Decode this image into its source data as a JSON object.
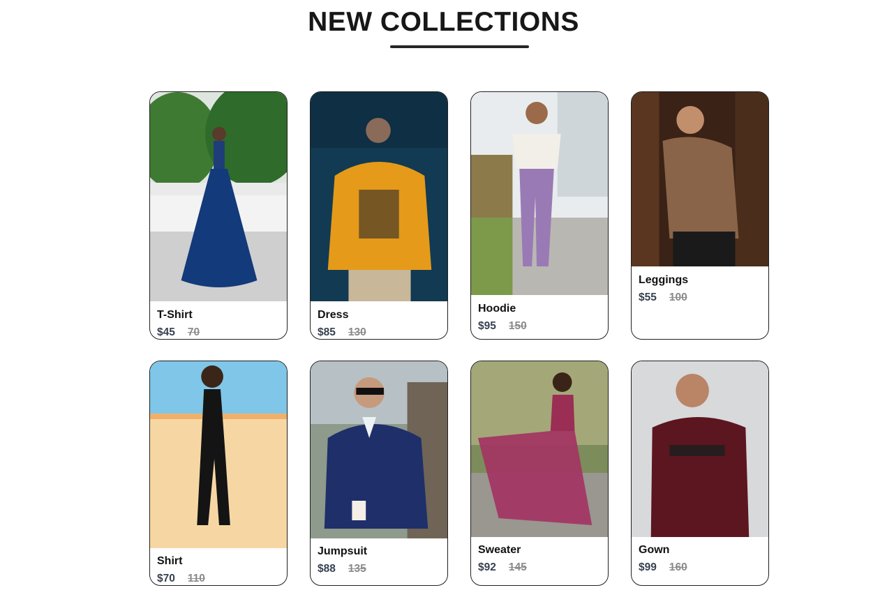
{
  "section": {
    "title": "NEW COLLECTIONS"
  },
  "products": [
    {
      "name": "T-Shirt",
      "new_price": "$45",
      "old_price": "70"
    },
    {
      "name": "Dress",
      "new_price": "$85",
      "old_price": "130"
    },
    {
      "name": "Hoodie",
      "new_price": "$95",
      "old_price": "150"
    },
    {
      "name": "Leggings",
      "new_price": "$55",
      "old_price": "100"
    },
    {
      "name": "Shirt",
      "new_price": "$70",
      "old_price": "110"
    },
    {
      "name": "Jumpsuit",
      "new_price": "$88",
      "old_price": "135"
    },
    {
      "name": "Sweater",
      "new_price": "$92",
      "old_price": "145"
    },
    {
      "name": "Gown",
      "new_price": "$99",
      "old_price": "160"
    }
  ]
}
